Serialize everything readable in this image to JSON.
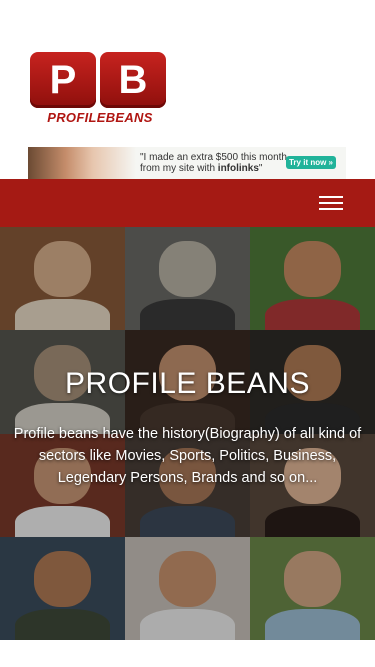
{
  "logo": {
    "letter_left": "P",
    "letter_right": "B",
    "wordmark": "PROFILEBEANS"
  },
  "ad": {
    "quote_line1": "\"I made an extra  $500 this month",
    "quote_line2_prefix": "from my site with",
    "quote_brand": "infolinks",
    "quote_end": "\"",
    "button_label": "Try it now »",
    "image_icon": "person-photo"
  },
  "nav": {
    "menu_icon": "hamburger-icon",
    "background": "#a51a14"
  },
  "hero": {
    "title": "PROFILE BEANS",
    "description": "Profile beans have the history(Biography) of all kind of sectors like Movies, Sports, Politics, Business, Legendary Persons, Brands and so on..."
  },
  "tiles": [
    {
      "bg": "#8a5a3a",
      "face": "#d9b08c",
      "cloth": "#e9dcc6"
    },
    {
      "bg": "#6a6a66",
      "face": "#b9b3a6",
      "cloth": "#3b3b3b"
    },
    {
      "bg": "#4f7a3a",
      "face": "#c68b62",
      "cloth": "#b23a3a"
    },
    {
      "bg": "#565650",
      "face": "#a8927a",
      "cloth": "#d7d3c9"
    },
    {
      "bg": "#3a2a22",
      "face": "#c49270",
      "cloth": "#4a3a30"
    },
    {
      "bg": "#2f2b28",
      "face": "#b07c55",
      "cloth": "#2b2b2b"
    },
    {
      "bg": "#7a3a2a",
      "face": "#c99876",
      "cloth": "#f1f1f1"
    },
    {
      "bg": "#4a3f38",
      "face": "#a87858",
      "cloth": "#3d4a5a"
    },
    {
      "bg": "#5a4a3e",
      "face": "#e2b898",
      "cloth": "#2a1e1a"
    },
    {
      "bg": "#3b4d5e",
      "face": "#b17a55",
      "cloth": "#3f4a3a"
    },
    {
      "bg": "#c9c3bb",
      "face": "#c9946e",
      "cloth": "#efefef"
    },
    {
      "bg": "#6c8a4a",
      "face": "#d3a886",
      "cloth": "#9ec0d6"
    }
  ]
}
